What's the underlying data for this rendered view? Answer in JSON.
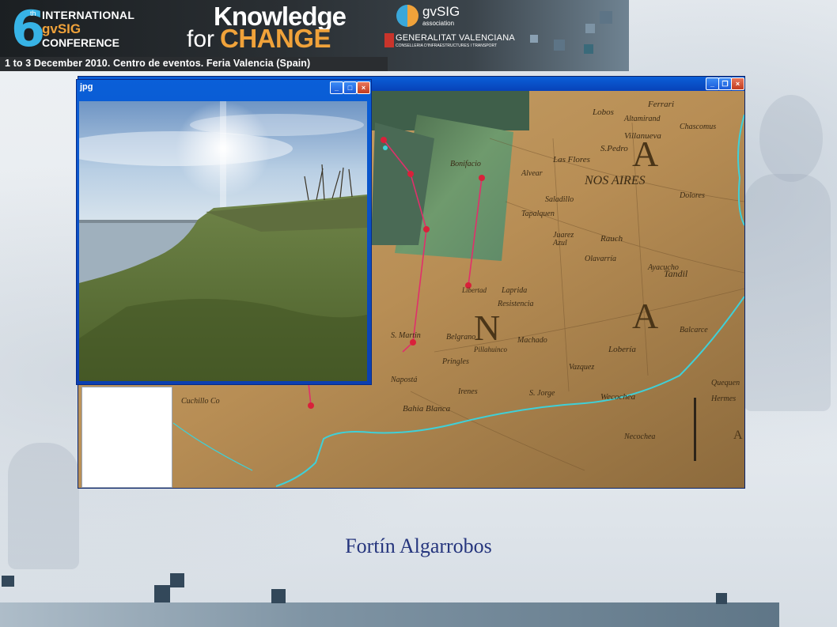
{
  "banner": {
    "edition_number": "6",
    "edition_suffix": "th",
    "line1": "INTERNATIONAL",
    "line2": "gvSIG",
    "line3": "CONFERENCE",
    "slogan_top": "Knowledge",
    "slogan_for": "for",
    "slogan_change": "CHANGE",
    "gvsig_mark": "gvSIG",
    "gvsig_sub": "association",
    "sponsor": "GENERALITAT VALENCIANA",
    "sponsor_sub": "CONSELLERIA D'INFRAESTRUCTURES I TRANSPORT",
    "date_line": "1 to 3 December 2010. Centro de eventos. Feria Valencia (Spain)"
  },
  "photo_window": {
    "title": "jpg",
    "buttons": {
      "minimize": "_",
      "maximize": "□",
      "close": "×"
    }
  },
  "map_window": {
    "buttons": {
      "minimize": "_",
      "restore": "❐",
      "close": "×"
    }
  },
  "map_labels": [
    "NOS AIRES",
    "Lobos",
    "Ferrari",
    "Altamirand",
    "Villanueva",
    "Chascomus",
    "S.Pedro",
    "Las Flores",
    "Alvear",
    "Tapalquen",
    "Rauch",
    "Dolores",
    "Ayacucho",
    "Tandil",
    "Juarez",
    "Laprida",
    "Resistencia",
    "Libertad",
    "S. Martin",
    "Belgrano",
    "Pringles",
    "S. Jorge",
    "Bahia Blanca",
    "Wecochea",
    "Balcarce",
    "Vazquez",
    "Lobería",
    "Machado",
    "Cuchillo Co",
    "Napostá",
    "Irenes",
    "Bonifacio",
    "Saladillo",
    "Azul",
    "Olavarría",
    "Pillahuinco",
    "Quequen",
    "Necochea",
    "Hermes"
  ],
  "map_big_letters": [
    "A",
    "N",
    "A"
  ],
  "caption": "Fortín Algarrobos",
  "colors": {
    "caption": "#25357d",
    "accent_orange": "#f0a23a",
    "accent_blue": "#37b3e6",
    "xp_title": "#0a5fd8",
    "route_pink": "#e0306b",
    "route_red": "#d9213a",
    "coast_cyan": "#3fd0d8"
  }
}
